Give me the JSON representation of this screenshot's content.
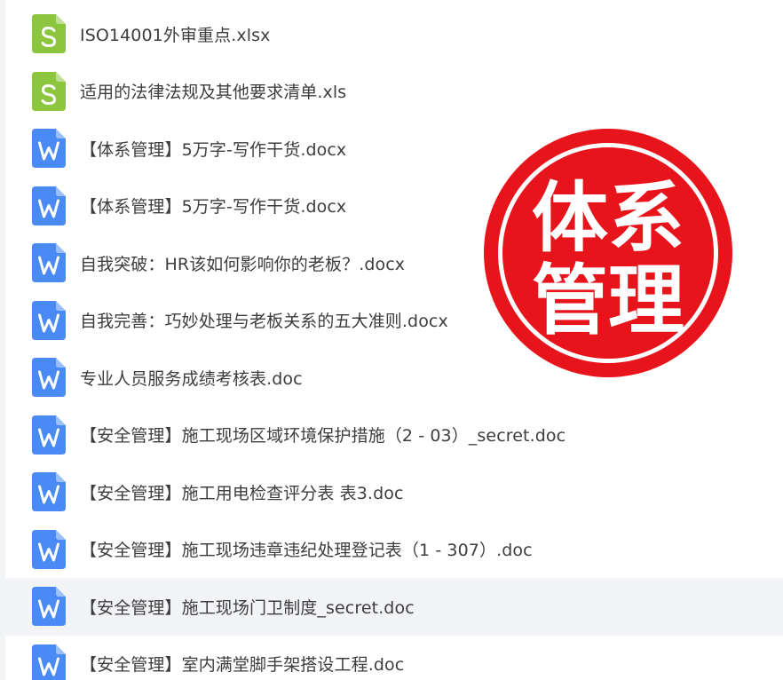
{
  "files": [
    {
      "name": "ISO14001外审重点.xlsx",
      "type": "spreadsheet",
      "icon": "spreadsheet-file-icon",
      "icon_letter": "S",
      "color": "#8cc63f"
    },
    {
      "name": "适用的法律法规及其他要求清单.xls",
      "type": "spreadsheet",
      "icon": "spreadsheet-file-icon",
      "icon_letter": "S",
      "color": "#8cc63f"
    },
    {
      "name": "【体系管理】5万字-写作干货.docx",
      "type": "document",
      "icon": "word-file-icon",
      "icon_letter": "W",
      "color": "#4a8af4"
    },
    {
      "name": "【体系管理】5万字-写作干货.docx",
      "type": "document",
      "icon": "word-file-icon",
      "icon_letter": "W",
      "color": "#4a8af4"
    },
    {
      "name": "自我突破：HR该如何影响你的老板？.docx",
      "type": "document",
      "icon": "word-file-icon",
      "icon_letter": "W",
      "color": "#4a8af4"
    },
    {
      "name": "自我完善：巧妙处理与老板关系的五大准则.docx",
      "type": "document",
      "icon": "word-file-icon",
      "icon_letter": "W",
      "color": "#4a8af4"
    },
    {
      "name": "专业人员服务成绩考核表.doc",
      "type": "document",
      "icon": "word-file-icon",
      "icon_letter": "W",
      "color": "#4a8af4"
    },
    {
      "name": "【安全管理】施工现场区域环境保护措施（2 - 03）_secret.doc",
      "type": "document",
      "icon": "word-file-icon",
      "icon_letter": "W",
      "color": "#4a8af4"
    },
    {
      "name": "【安全管理】施工用电检查评分表 表3.doc",
      "type": "document",
      "icon": "word-file-icon",
      "icon_letter": "W",
      "color": "#4a8af4"
    },
    {
      "name": "【安全管理】施工现场违章违纪处理登记表（1 - 307）.doc",
      "type": "document",
      "icon": "word-file-icon",
      "icon_letter": "W",
      "color": "#4a8af4"
    },
    {
      "name": "【安全管理】施工现场门卫制度_secret.doc",
      "type": "document",
      "icon": "word-file-icon",
      "icon_letter": "W",
      "color": "#4a8af4",
      "selected": true
    },
    {
      "name": "【安全管理】室内满堂脚手架搭设工程.doc",
      "type": "document",
      "icon": "word-file-icon",
      "icon_letter": "W",
      "color": "#4a8af4"
    }
  ],
  "stamp": {
    "line1": "体系",
    "line2": "管理",
    "color": "#e8141b"
  }
}
